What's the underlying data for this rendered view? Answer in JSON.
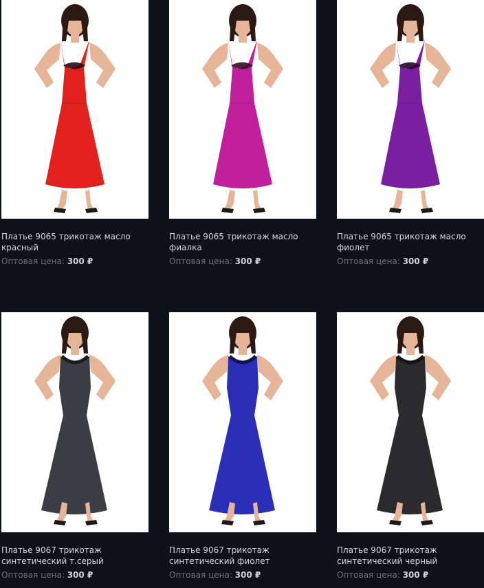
{
  "products": [
    {
      "title": "Платье 9065 трикотаж масло красный",
      "price_label": "Оптовая цена:",
      "price_value": "300 ₽",
      "dress_color": "#e3211c",
      "accent_color": "#2a0b12",
      "style": "v-neck"
    },
    {
      "title": "Платье 9065 трикотаж масло фиалка",
      "price_label": "Оптовая цена:",
      "price_value": "300 ₽",
      "dress_color": "#c21f9d",
      "accent_color": "#3a0a26",
      "style": "v-neck"
    },
    {
      "title": "Платье 9065 трикотаж масло фиолет",
      "price_label": "Оптовая цена:",
      "price_value": "300 ₽",
      "dress_color": "#7b1fa2",
      "accent_color": "#23082c",
      "style": "v-neck"
    },
    {
      "title": "Платье 9067 трикотаж синтетический т.серый",
      "price_label": "Оптовая цена:",
      "price_value": "300 ₽",
      "dress_color": "#3b3d44",
      "accent_color": "#1b1c20",
      "style": "tank"
    },
    {
      "title": "Платье 9067 трикотаж синтетический фиолет",
      "price_label": "Оптовая цена:",
      "price_value": "300 ₽",
      "dress_color": "#2a2fb8",
      "accent_color": "#101450",
      "style": "tank"
    },
    {
      "title": "Платье 9067 трикотаж синтетический черный",
      "price_label": "Оптовая цена:",
      "price_value": "300 ₽",
      "dress_color": "#2b2b2e",
      "accent_color": "#141416",
      "style": "tank"
    }
  ]
}
